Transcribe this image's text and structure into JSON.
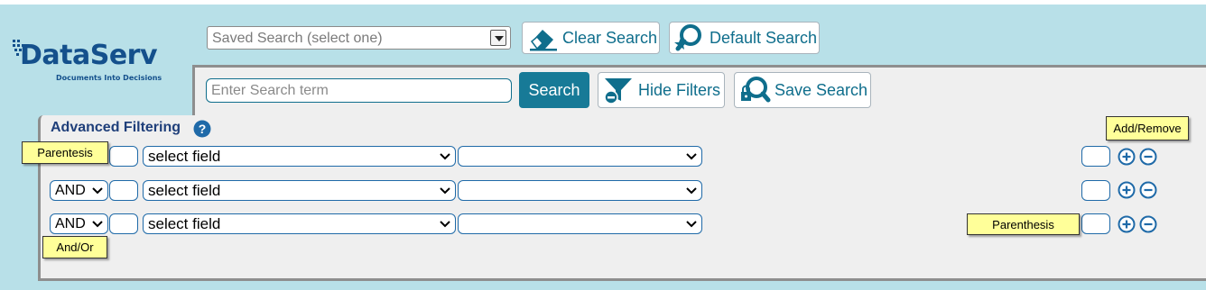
{
  "logo": {
    "name": "DataServ",
    "tagline": "Documents Into Decisions"
  },
  "saved_search": {
    "placeholder": "Saved Search (select one)"
  },
  "toolbar": {
    "clear_label": "Clear Search",
    "default_label": "Default Search",
    "search_label": "Search",
    "hide_filters_label": "Hide Filters",
    "save_search_label": "Save Search"
  },
  "search": {
    "placeholder": "Enter Search term"
  },
  "advanced": {
    "title": "Advanced Filtering",
    "rows": [
      {
        "connector": "",
        "field": "select field",
        "operator": ""
      },
      {
        "connector": "AND",
        "field": "select field",
        "operator": ""
      },
      {
        "connector": "AND",
        "field": "select field",
        "operator": ""
      }
    ]
  },
  "tooltips": {
    "parentesis": "Parentesis",
    "add_remove": "Add/Remove",
    "parenthesis": "Parenthesis",
    "and_or": "And/Or"
  },
  "colors": {
    "accent": "#177a97",
    "brand": "#14508c",
    "background": "#b8e0e8"
  },
  "icons": [
    "eraser-icon",
    "search-star-icon",
    "funnel-minus-icon",
    "search-lock-icon",
    "help-icon",
    "plus-circle-icon",
    "minus-circle-icon",
    "chevron-down-icon"
  ]
}
